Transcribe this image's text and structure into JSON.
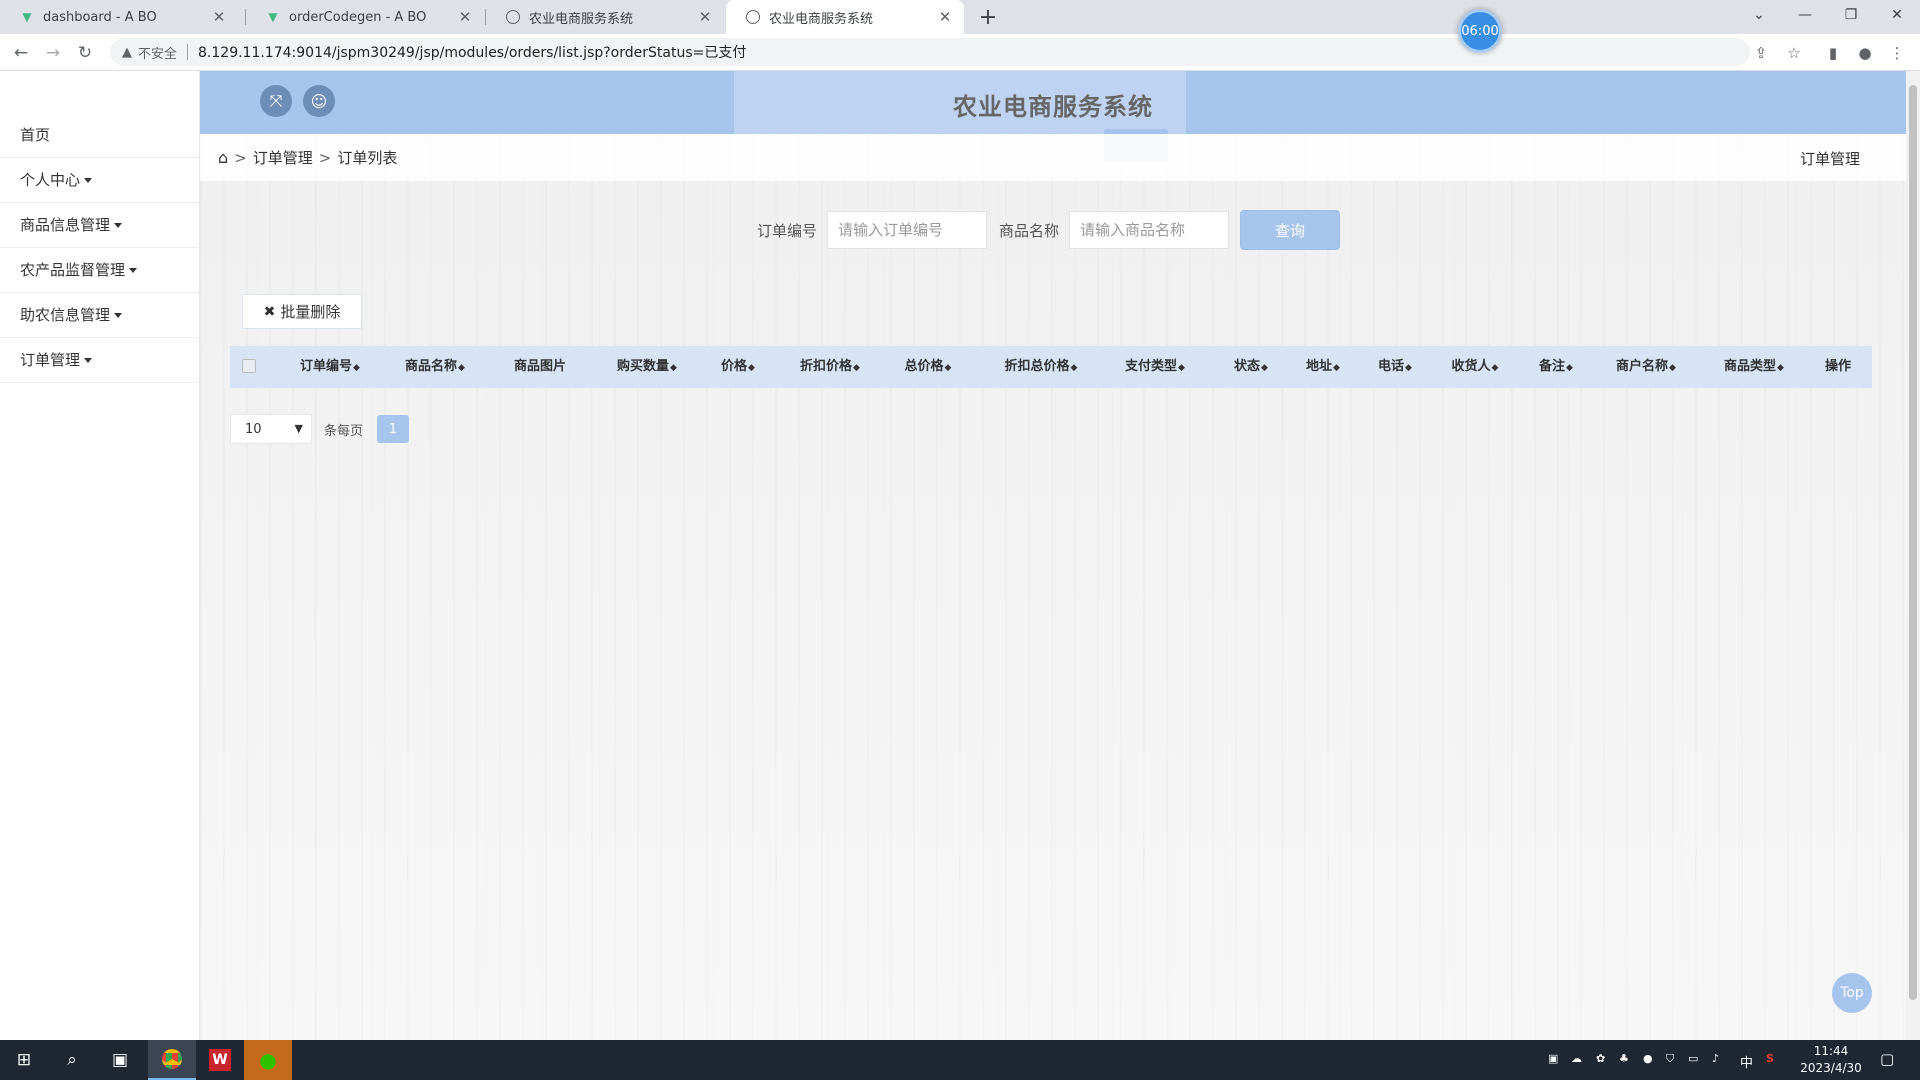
{
  "browser": {
    "tabs": [
      {
        "title": "dashboard - A BO",
        "active": false
      },
      {
        "title": "orderCodegen - A BO",
        "active": false
      },
      {
        "title": "农业电商服务系统",
        "active": false
      },
      {
        "title": "农业电商服务系统",
        "active": true
      }
    ],
    "security_label": "不安全",
    "url": "8.129.11.174:9014/jspm30249/jsp/modules/orders/list.jsp?orderStatus=已支付",
    "timer": "06:00"
  },
  "header": {
    "system_title": "农业电商服务系统"
  },
  "sidebar": {
    "items": [
      {
        "label": "首页",
        "has_caret": false
      },
      {
        "label": "个人中心",
        "has_caret": true
      },
      {
        "label": "商品信息管理",
        "has_caret": true
      },
      {
        "label": "农产品监督管理",
        "has_caret": true
      },
      {
        "label": "助农信息管理",
        "has_caret": true
      },
      {
        "label": "订单管理",
        "has_caret": true
      }
    ]
  },
  "breadcrumb": {
    "level1": "订单管理",
    "level2": "订单列表",
    "right": "订单管理"
  },
  "search": {
    "order_no_label": "订单编号",
    "order_no_placeholder": "请输入订单编号",
    "goods_name_label": "商品名称",
    "goods_name_placeholder": "请输入商品名称",
    "query_label": "查询"
  },
  "actions": {
    "batch_delete_label": "批量删除"
  },
  "table": {
    "columns": [
      {
        "label": "订单编号",
        "sortable": true
      },
      {
        "label": "商品名称",
        "sortable": true
      },
      {
        "label": "商品图片",
        "sortable": false
      },
      {
        "label": "购买数量",
        "sortable": true
      },
      {
        "label": "价格",
        "sortable": true
      },
      {
        "label": "折扣价格",
        "sortable": true
      },
      {
        "label": "总价格",
        "sortable": true
      },
      {
        "label": "折扣总价格",
        "sortable": true
      },
      {
        "label": "支付类型",
        "sortable": true
      },
      {
        "label": "状态",
        "sortable": true
      },
      {
        "label": "地址",
        "sortable": true
      },
      {
        "label": "电话",
        "sortable": true
      },
      {
        "label": "收货人",
        "sortable": true
      },
      {
        "label": "备注",
        "sortable": true
      },
      {
        "label": "商户名称",
        "sortable": true
      },
      {
        "label": "商品类型",
        "sortable": true
      },
      {
        "label": "操作",
        "sortable": false
      }
    ],
    "rows": []
  },
  "pagination": {
    "page_size": "10",
    "per_page_label": "条每页",
    "current_page": "1"
  },
  "top_button": "Top",
  "taskbar": {
    "time": "11:44",
    "date": "2023/4/30",
    "ime": "中"
  }
}
